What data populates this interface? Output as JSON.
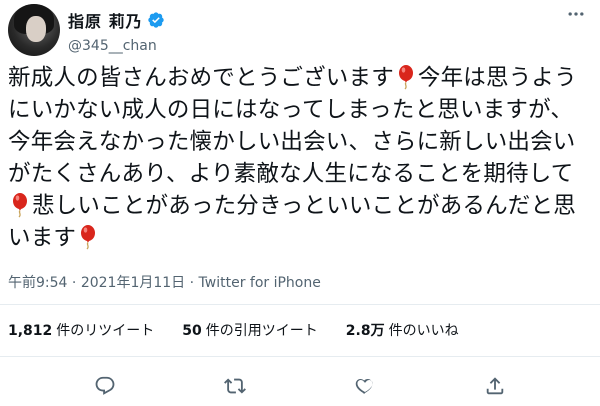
{
  "user": {
    "display_name": "指原 莉乃",
    "handle": "@345__chan",
    "verified": true
  },
  "icons": {
    "more": "more-icon",
    "verified": "verified-badge-icon",
    "emoji": "balloon-emoji",
    "reply": "reply-icon",
    "retweet": "retweet-icon",
    "like": "like-icon",
    "share": "share-icon"
  },
  "tweet": {
    "seg1": "新成人の皆さんおめでとうございます",
    "seg2": "今年は思うようにいかない成人の日にはなってしまったと思いますが、今年会えなかった懐かしい出会い、さらに新しい出会いがたくさんあり、より素敵な人生になることを期待して",
    "seg3": "悲しいことがあった分きっといいことがあるんだと思います"
  },
  "meta": {
    "time": "午前9:54",
    "sep1": " · ",
    "date": "2021年1月11日",
    "sep2": " · ",
    "source": "Twitter for iPhone"
  },
  "stats": {
    "retweets_count": "1,812",
    "retweets_label": "件のリツイート",
    "quotes_count": "50",
    "quotes_label": "件の引用ツイート",
    "likes_count": "2.8万",
    "likes_label": "件のいいね"
  },
  "colors": {
    "text": "#0f1419",
    "secondary": "#536471",
    "verified": "#1d9bf0",
    "balloon": "#d9261c"
  }
}
